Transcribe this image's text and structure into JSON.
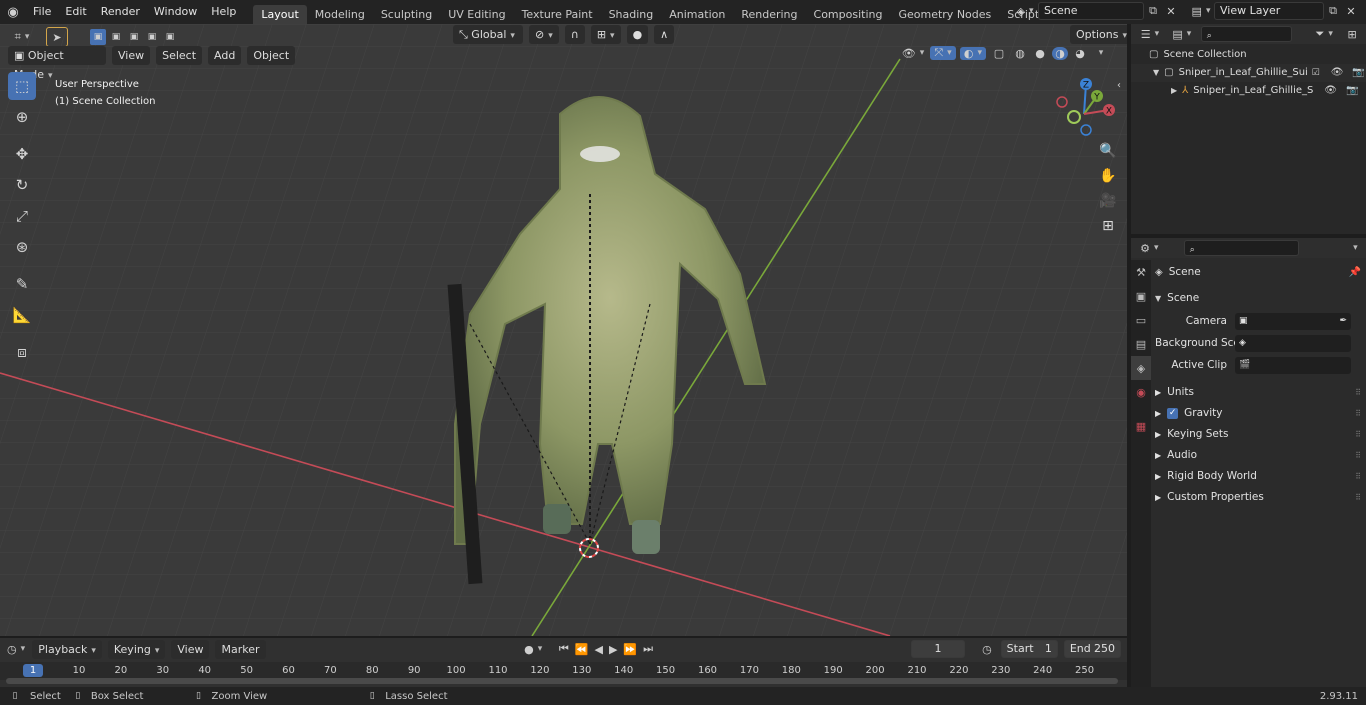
{
  "menu": [
    "File",
    "Edit",
    "Render",
    "Window",
    "Help"
  ],
  "workspaces": [
    "Layout",
    "Modeling",
    "Sculpting",
    "UV Editing",
    "Texture Paint",
    "Shading",
    "Animation",
    "Rendering",
    "Compositing",
    "Geometry Nodes",
    "Scripting"
  ],
  "active_workspace": "Layout",
  "scene_name": "Scene",
  "view_layer": "View Layer",
  "viewport": {
    "mode": "Object Mode",
    "menus": [
      "View",
      "Select",
      "Add",
      "Object"
    ],
    "transform_orientation": "Global",
    "options_label": "Options",
    "overlay_title": "User Perspective",
    "overlay_collection": "(1) Scene Collection",
    "gizmo_axes": [
      "Z",
      "Y",
      "X"
    ]
  },
  "outliner": {
    "root": "Scene Collection",
    "items": [
      {
        "name": "Sniper_in_Leaf_Ghillie_Suit_T_"
      },
      {
        "name": "Sniper_in_Leaf_Ghillie_Su"
      }
    ]
  },
  "properties": {
    "context": "Scene",
    "panel_title": "Scene",
    "fields": [
      {
        "label": "Camera"
      },
      {
        "label": "Background Scene"
      },
      {
        "label": "Active Clip"
      }
    ],
    "subpanels": [
      "Units",
      "Gravity",
      "Keying Sets",
      "Audio",
      "Rigid Body World",
      "Custom Properties"
    ],
    "gravity_checked": true
  },
  "timeline": {
    "menus": [
      "Playback",
      "Keying",
      "View",
      "Marker"
    ],
    "current_frame": "1",
    "start_label": "Start",
    "start": "1",
    "end_label": "End",
    "end": "250",
    "ruler": [
      "1",
      "10",
      "20",
      "30",
      "40",
      "50",
      "60",
      "70",
      "80",
      "90",
      "100",
      "110",
      "120",
      "130",
      "140",
      "150",
      "160",
      "170",
      "180",
      "190",
      "200",
      "210",
      "220",
      "230",
      "240",
      "250"
    ]
  },
  "statusbar": {
    "select": "Select",
    "box_select": "Box Select",
    "zoom_view": "Zoom View",
    "lasso_select": "Lasso Select",
    "version": "2.93.11"
  },
  "colors": {
    "accent": "#4772b3",
    "x_axis": "#c44b57",
    "y_axis": "#7aa83a",
    "z_axis": "#3b82d6"
  }
}
